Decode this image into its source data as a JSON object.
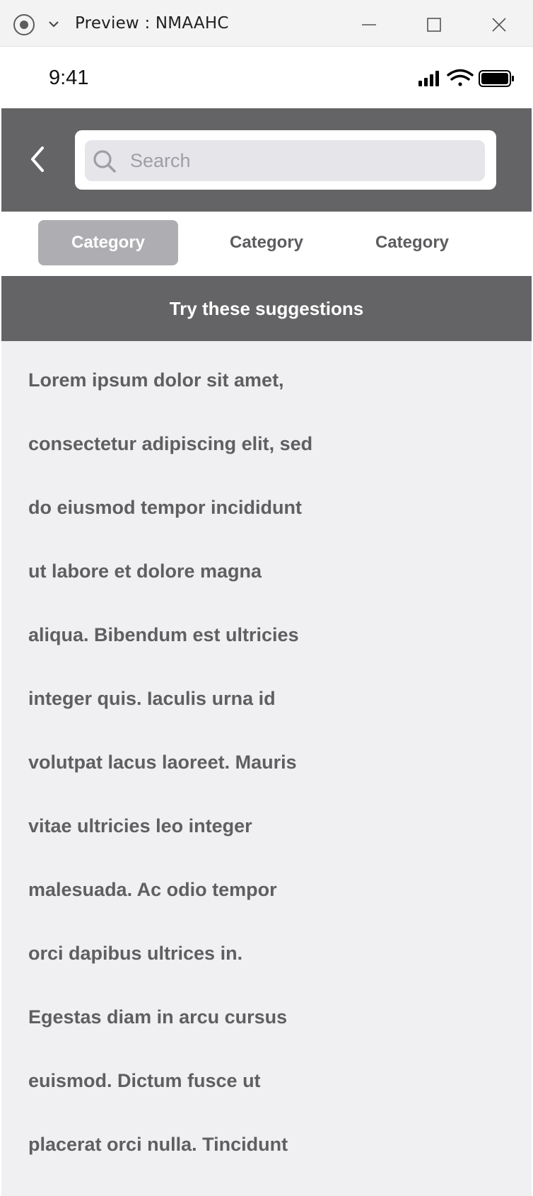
{
  "window": {
    "title": "Preview : NMAAHC",
    "icons": [
      "record-icon",
      "chevron-down-icon",
      "minimize-icon",
      "maximize-icon",
      "close-icon"
    ]
  },
  "status_bar": {
    "time": "9:41",
    "icons": [
      "signal-icon",
      "wifi-icon",
      "battery-icon"
    ]
  },
  "search": {
    "placeholder": "Search",
    "value": ""
  },
  "tabs": [
    {
      "label": "Category",
      "active": true
    },
    {
      "label": "Category",
      "active": false
    },
    {
      "label": "Category",
      "active": false
    }
  ],
  "suggestions": {
    "header": "Try these suggestions",
    "items": [
      " Lorem ipsum dolor sit amet,",
      "consectetur adipiscing elit, sed",
      "do eiusmod tempor incididunt",
      "ut labore et dolore magna",
      "aliqua. Bibendum est ultricies",
      "integer quis. Iaculis urna id",
      "volutpat lacus laoreet. Mauris",
      "vitae ultricies leo integer",
      "malesuada. Ac odio tempor",
      "orci dapibus ultrices in.",
      "Egestas diam in arcu cursus",
      "euismod. Dictum fusce ut",
      "placerat orci nulla. Tincidunt"
    ]
  },
  "colors": {
    "header_bg": "#646466",
    "tab_active_bg": "#aeaeb2",
    "content_bg": "#f0f0f2",
    "text": "#5f5f62"
  }
}
